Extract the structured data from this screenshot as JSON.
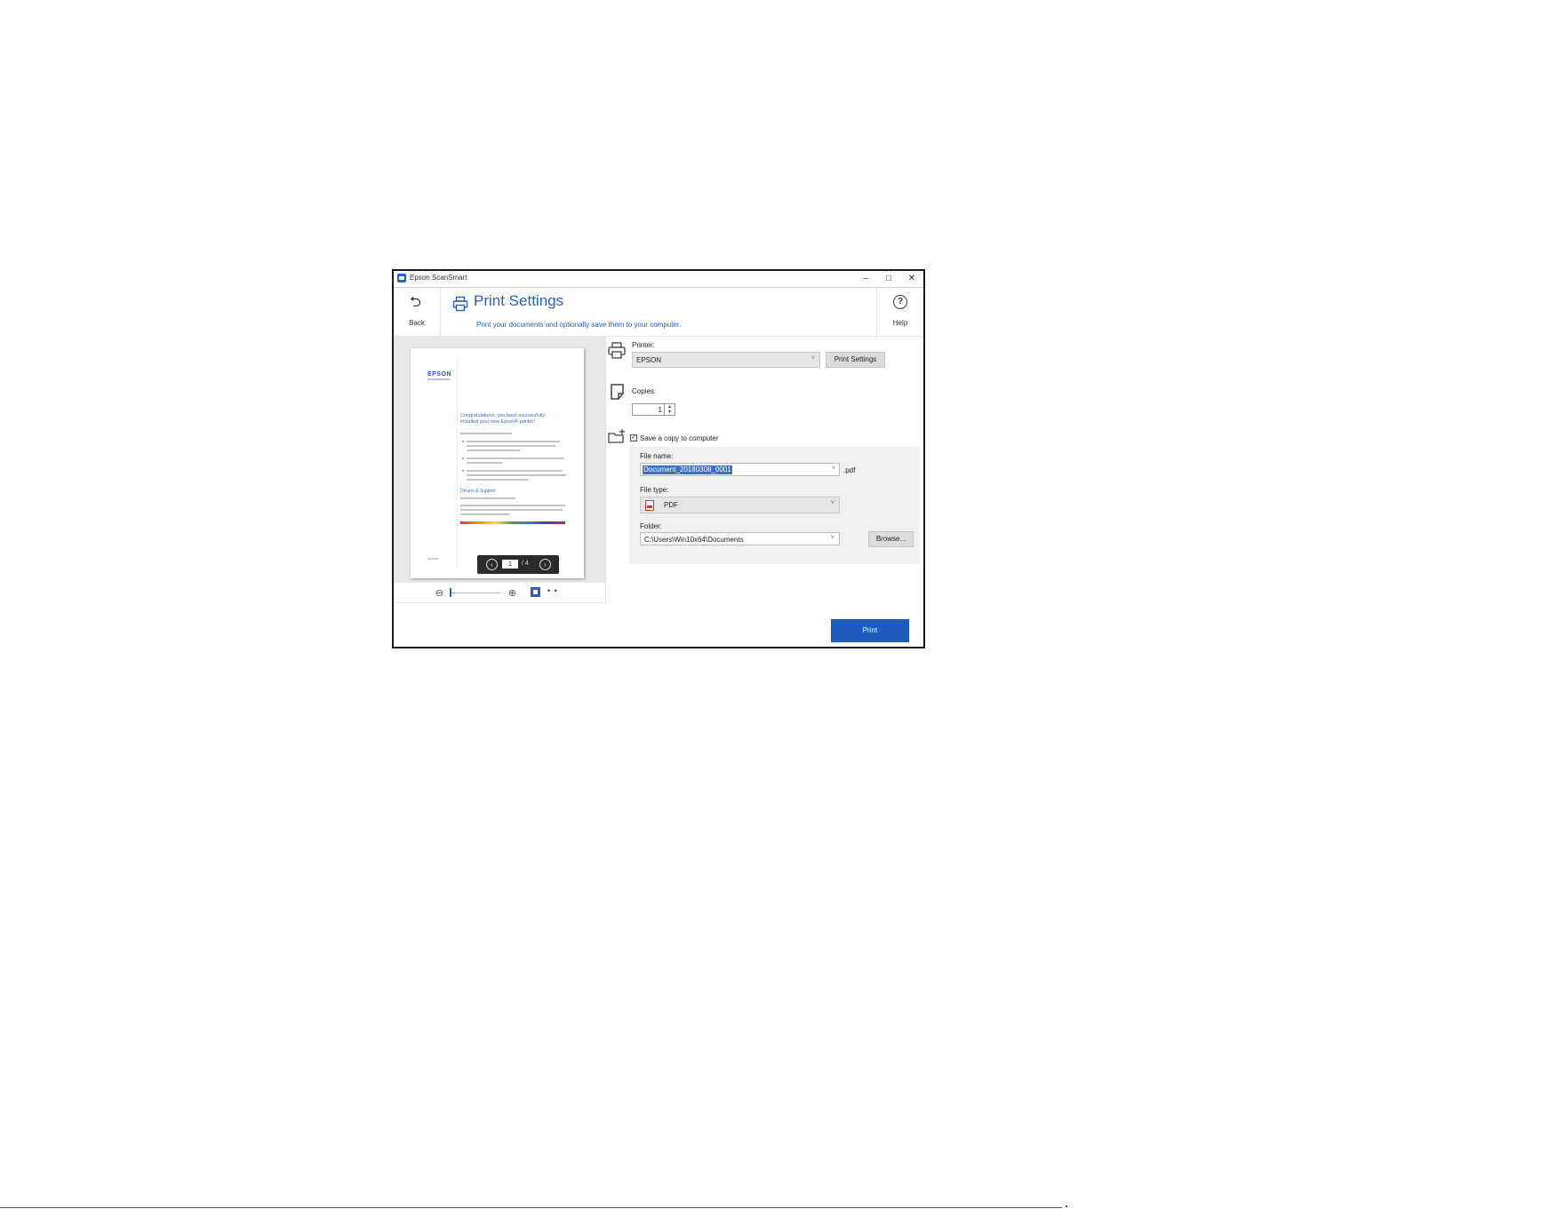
{
  "window": {
    "title": "Epson ScanSmart"
  },
  "titlebar": {
    "minimize": "–",
    "maximize": "□",
    "close": "✕"
  },
  "header": {
    "back_label": "Back",
    "title": "Print Settings",
    "subtitle": "Print your documents and optionally save them to your computer.",
    "help_label": "Help",
    "back_icon": "back-arrow-icon",
    "help_icon": "question-circle-icon"
  },
  "preview": {
    "logo": "EPSON",
    "heading": "Congratulations, you have successfully installed your new Epson® printer!",
    "subheading": "Drivers & Support",
    "page_current": "1",
    "page_total": "/ 4",
    "prev_glyph": "‹",
    "next_glyph": "›"
  },
  "zoom": {
    "out_glyph": "⊖",
    "in_glyph": "⊕",
    "more_glyph": "• •"
  },
  "form": {
    "printer_label": "Printer:",
    "printer_value": "EPSON",
    "print_settings_button": "Print Settings",
    "copies_label": "Copies:",
    "copies_value": "1",
    "save_copy_label": "Save a copy to computer",
    "save_copy_checked": true,
    "file_name_label": "File name:",
    "file_name_value": "Document_20180308_0001",
    "file_ext": ".pdf",
    "file_type_label": "File type:",
    "file_type_value": "PDF",
    "folder_label": "Folder:",
    "folder_value": "C:\\Users\\Win10x64\\Documents",
    "browse_button": "Browse...",
    "caret": "˅"
  },
  "footer": {
    "print_button": "Print"
  },
  "colors": {
    "accent": "#2a5fbd",
    "primary_button": "#1f5cc0",
    "selection": "#3f6fc8"
  }
}
